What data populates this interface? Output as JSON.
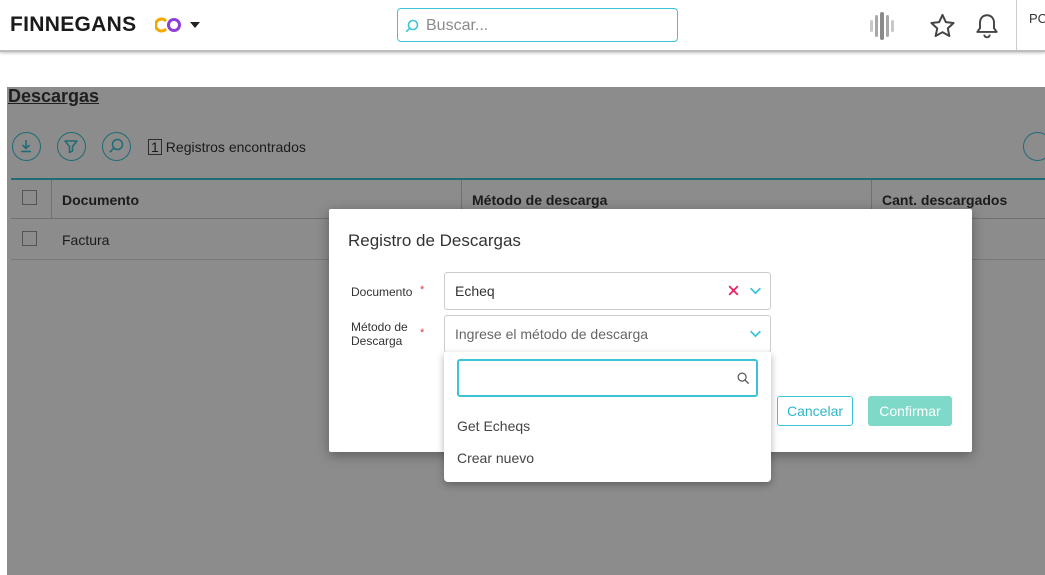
{
  "header": {
    "brand": "FINNEGANS",
    "search_placeholder": "Buscar...",
    "user_initials": "PC"
  },
  "page": {
    "title": "Descargas",
    "records_count": "1",
    "records_label": "Registros encontrados"
  },
  "grid": {
    "columns": [
      "Documento",
      "Método de descarga",
      "Cant. descargados"
    ],
    "rows": [
      {
        "documento": "Factura"
      }
    ]
  },
  "dialog": {
    "title": "Registro de Descargas",
    "documento_label": "Documento",
    "documento_value": "Echeq",
    "metodo_label_line1": "Método de",
    "metodo_label_line2": "Descarga",
    "metodo_placeholder": "Ingrese el método de descarga",
    "required_mark": "*",
    "cancel_label": "Cancelar",
    "confirm_label": "Confirmar"
  },
  "dropdown": {
    "search_value": "",
    "options": [
      "Get Echeqs",
      "Crear nuevo"
    ]
  },
  "colors": {
    "accent": "#3cc4d6",
    "confirm": "#7fd9c9",
    "required": "#e53935",
    "clear": "#e91e63"
  }
}
